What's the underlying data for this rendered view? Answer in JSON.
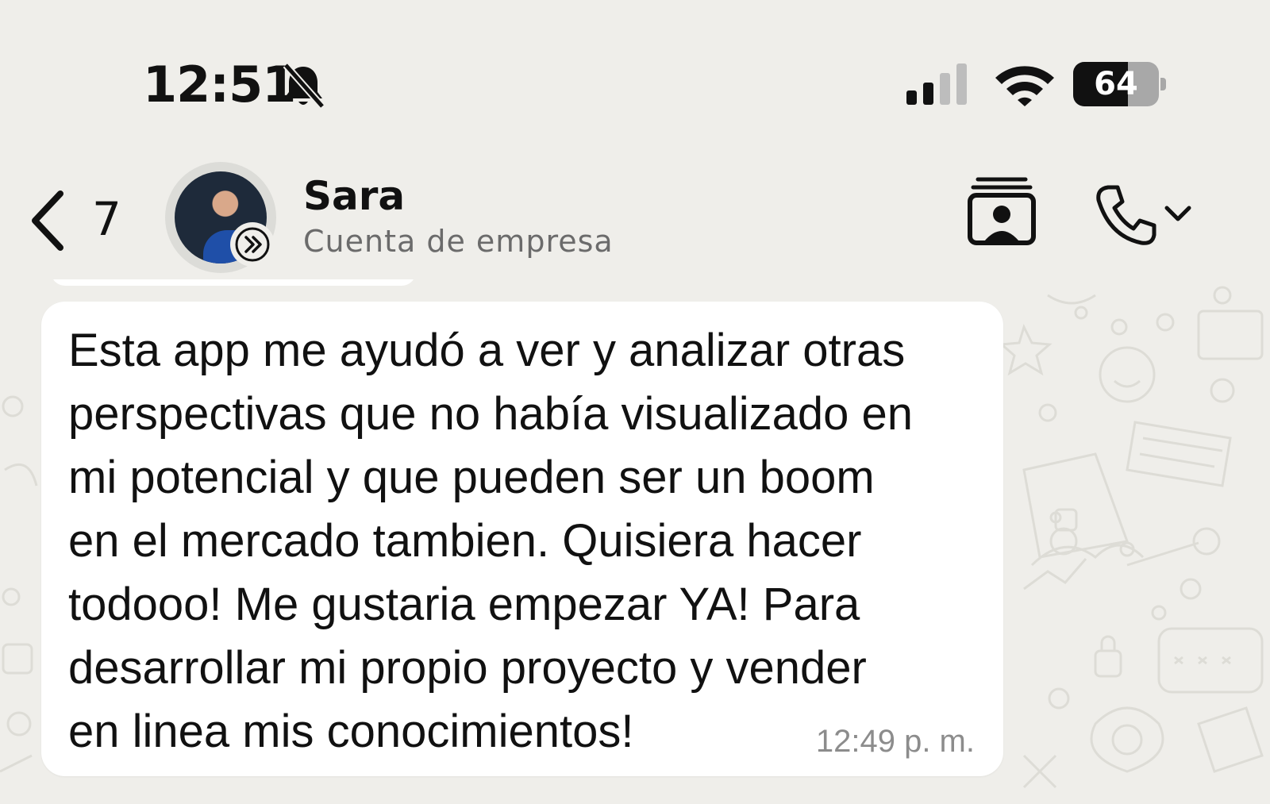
{
  "status_bar": {
    "time": "12:51",
    "battery_level": "64",
    "battery_fraction": 0.64,
    "icons": [
      "bell-slash-icon",
      "signal-icon",
      "wifi-icon",
      "battery-icon"
    ]
  },
  "header": {
    "back_count": "7",
    "contact_name": "Sara",
    "contact_subtitle": "Cuenta de empresa",
    "icons": [
      "chevron-left-icon",
      "contact-card-icon",
      "phone-icon",
      "chevron-down-icon",
      "forward-badge-icon"
    ]
  },
  "message": {
    "text": "Esta app me ayudó a ver y analizar otras\nperspectivas que no había visualizado en\nmi potencial y que pueden ser un boom\nen el mercado tambien. Quisiera hacer\ntodooo! Me gustaria empezar YA! Para\ndesarrollar mi propio proyecto y vender\nen linea mis conocimientos!",
    "time": "12:49 p. m."
  },
  "colors": {
    "background": "#efeeea",
    "bubble": "#ffffff",
    "subtitle": "#6b6b6b",
    "timestamp": "#8c8c8c"
  }
}
